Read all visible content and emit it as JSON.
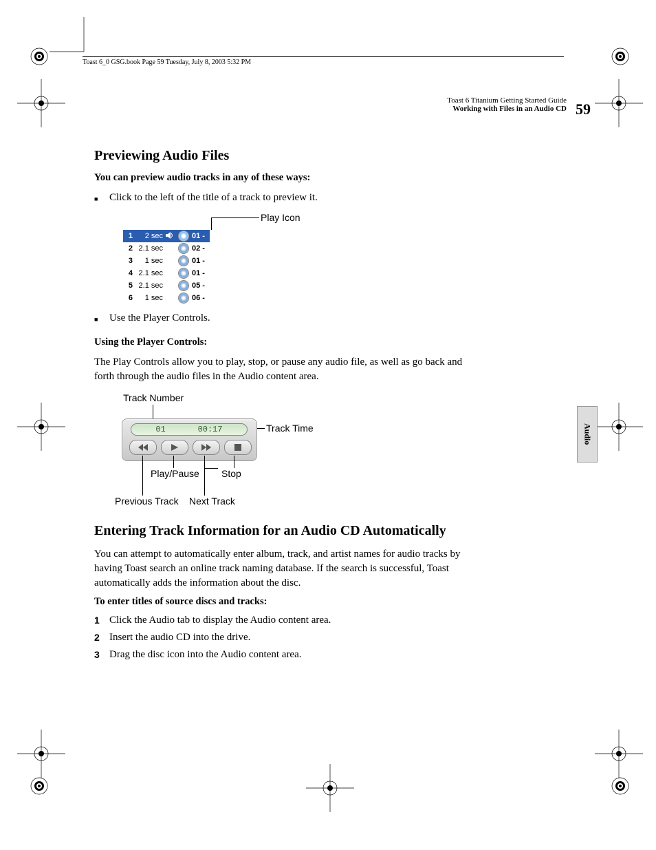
{
  "header_footer_line": "Toast 6_0 GSG.book  Page 59  Tuesday, July 8, 2003  5:32 PM",
  "running_head": {
    "line1": "Toast 6 Titanium Getting Started Guide",
    "line2": "Working with Files in an Audio CD"
  },
  "page_number": "59",
  "side_tab": "Audio",
  "h2a": "Previewing Audio Files",
  "lead1": "You can preview audio tracks in any of these ways:",
  "bullet1": "Click to the left of the title of a track to preview it.",
  "fig1": {
    "label": "Play Icon",
    "rows": [
      {
        "n": "1",
        "d": "2 sec",
        "t": "01 -",
        "sel": true,
        "spk": true
      },
      {
        "n": "2",
        "d": "2.1 sec",
        "t": "02 -"
      },
      {
        "n": "3",
        "d": "1 sec",
        "t": "01 -"
      },
      {
        "n": "4",
        "d": "2.1 sec",
        "t": "01 -"
      },
      {
        "n": "5",
        "d": "2.1 sec",
        "t": "05 -"
      },
      {
        "n": "6",
        "d": "1 sec",
        "t": "06 -"
      }
    ]
  },
  "bullet2": "Use the Player Controls.",
  "lead2": "Using the Player Controls:",
  "para1": "The Play Controls allow you to play, stop, or pause any audio file, as well as go back and forth through the audio files in the Audio content area.",
  "fig2": {
    "track_number_label": "Track Number",
    "track_time_label": "Track Time",
    "play_pause_label": "Play/Pause",
    "stop_label": "Stop",
    "prev_label": "Previous Track",
    "next_label": "Next Track",
    "lcd_track": "01",
    "lcd_time": "00:17"
  },
  "h2b": "Entering Track Information for an Audio CD Automatically",
  "para2": "You can attempt to automatically enter album, track, and artist names for audio tracks by having Toast search an online track naming database. If the search is successful, Toast automatically adds the information about the disc.",
  "lead3": "To enter titles of source discs and tracks:",
  "steps": [
    "Click the Audio tab to display the Audio content area.",
    "Insert the audio CD into the drive.",
    "Drag the disc icon into the Audio content area."
  ]
}
